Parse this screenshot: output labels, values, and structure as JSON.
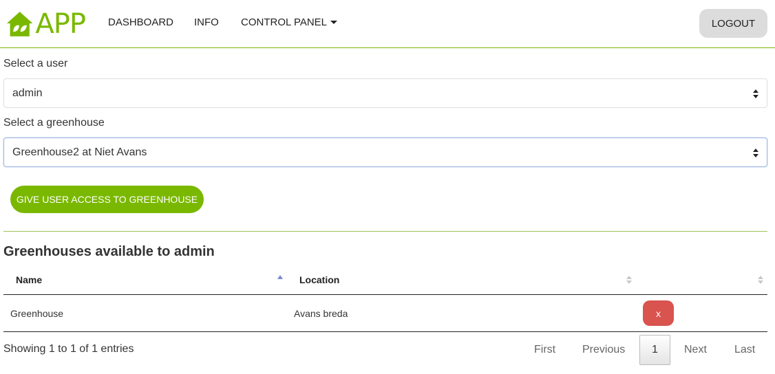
{
  "nav": {
    "brand_text": "APP",
    "brand_color": "#7ab800",
    "items": [
      {
        "label": "DASHBOARD"
      },
      {
        "label": "INFO"
      },
      {
        "label": "CONTROL PANEL"
      }
    ],
    "logout_label": "LOGOUT"
  },
  "form": {
    "user_label": "Select a user",
    "user_value": "admin",
    "greenhouse_label": "Select a greenhouse",
    "greenhouse_value": "Greenhouse2 at Niet Avans",
    "give_access_label": "GIVE USER ACCESS TO GREENHOUSE"
  },
  "table": {
    "title": "Greenhouses available to admin",
    "columns": [
      "Name",
      "Location",
      ""
    ],
    "sorted_column": "Name",
    "rows": [
      {
        "name": "Greenhouse",
        "location": "Avans breda",
        "action_label": "x"
      }
    ],
    "info": "Showing 1 to 1 of 1 entries",
    "pagination": {
      "first": "First",
      "previous": "Previous",
      "current": "1",
      "next": "Next",
      "last": "Last"
    }
  },
  "colors": {
    "accent": "#7ab800",
    "danger": "#d9534f",
    "logout_bg": "#dcdcdc"
  },
  "icons": [
    "house-leaf-logo-icon",
    "caret-down-icon",
    "select-arrows-icon",
    "sort-icon"
  ]
}
